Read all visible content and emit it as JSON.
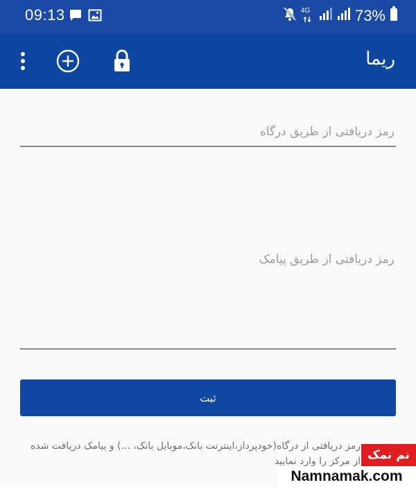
{
  "status_bar": {
    "time": "09:13",
    "network": "4G",
    "battery": "73%",
    "left_icons": [
      "message-icon",
      "image-icon"
    ],
    "right_icons": [
      "mute-icon",
      "network-4g-icon",
      "signal-icon",
      "signal-icon",
      "battery-icon"
    ]
  },
  "app_bar": {
    "title": "ریما",
    "actions": [
      "more-vert-icon",
      "add-circle-icon",
      "lock-icon"
    ]
  },
  "form": {
    "gateway_password_placeholder": "رمز دریافتی از طریق درگاه",
    "sms_password_placeholder": "رمز دریافتی از طریق پیامک",
    "submit_label": "ثبت"
  },
  "note": {
    "text": "رمز دریافتی از درگاه(خودپرداز،اینترنت بانک،موبایل بانک، ...) و پیامک دریافت شده از مرکز را وارد نمایید"
  },
  "watermark": {
    "brand": "نم نمک",
    "site": "Namnamak.com"
  },
  "colors": {
    "status_bar": "#1a4aa6",
    "app_bar": "#0e47a1",
    "button": "#0f47a2",
    "background": "#fafafa",
    "watermark_red": "#e01e22"
  }
}
